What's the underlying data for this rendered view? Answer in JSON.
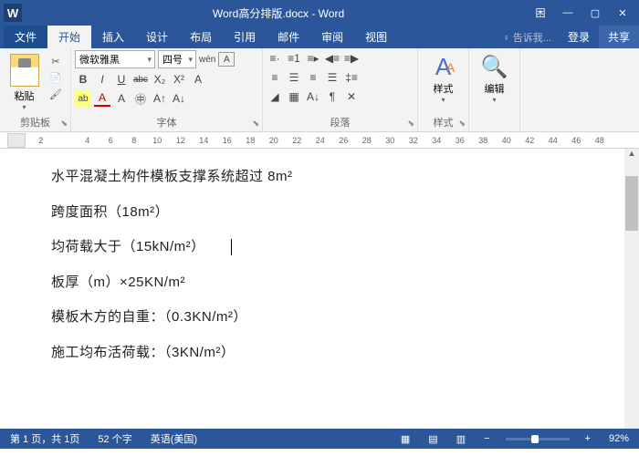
{
  "title": {
    "app_icon": "W",
    "filename": "Word高分排版.docx - Word"
  },
  "window": {
    "min": "—",
    "max": "▢",
    "close": "✕",
    "extra": "困"
  },
  "tabs": {
    "file": "文件",
    "home": "开始",
    "insert": "插入",
    "design": "设计",
    "layout": "布局",
    "references": "引用",
    "mailings": "邮件",
    "review": "审阅",
    "view": "视图",
    "tell": "♀ 告诉我...",
    "login": "登录",
    "share": "共享"
  },
  "ribbon": {
    "clipboard": {
      "paste": "粘贴",
      "label": "剪贴板"
    },
    "font": {
      "name": "微软雅黑",
      "size": "四号",
      "wen": "wén",
      "bold": "B",
      "italic": "I",
      "underline": "U",
      "strike": "abc",
      "sub": "X₂",
      "sup": "X²",
      "Aa": "A",
      "Ab": "A",
      "highlight": "ab",
      "color": "A",
      "clear": "A",
      "label": "字体"
    },
    "paragraph": {
      "label": "段落"
    },
    "styles": {
      "icon": "A",
      "label": "样式"
    },
    "editing": {
      "icon": "🔍",
      "label": "编辑"
    }
  },
  "ruler": {
    "nums": [
      "2",
      "",
      "4",
      "6",
      "8",
      "10",
      "12",
      "14",
      "16",
      "18",
      "20",
      "22",
      "24",
      "26",
      "28",
      "30",
      "32",
      "34",
      "36",
      "38",
      "40",
      "42",
      "44",
      "46",
      "48"
    ]
  },
  "document": {
    "p1": "水平混凝土构件模板支撑系统超过 8m²",
    "p2": "跨度面积（18m²）",
    "p3": "均荷载大于（15kN/m²）",
    "p4": "板厚（m）×25KN/m²",
    "p5": "模板木方的自重：（0.3KN/m²）",
    "p6": "施工均布活荷载：（3KN/m²）"
  },
  "status": {
    "page": "第 1 页，共 1页",
    "words": "52 个字",
    "lang": "英语(美国)",
    "zoom": "92%",
    "plus": "+",
    "minus": "−"
  }
}
